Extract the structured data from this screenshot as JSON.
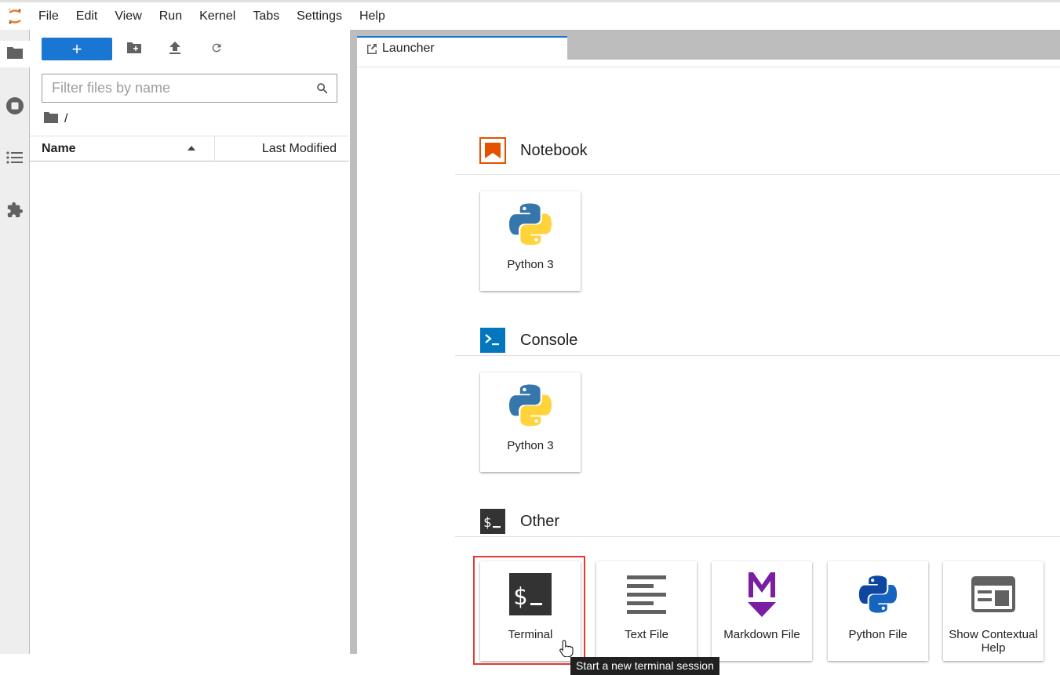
{
  "menubar": {
    "items": [
      "File",
      "Edit",
      "View",
      "Run",
      "Kernel",
      "Tabs",
      "Settings",
      "Help"
    ]
  },
  "activity_bar": {
    "icons": [
      "folder-icon",
      "running-icon",
      "toc-icon",
      "extension-icon"
    ]
  },
  "filebrowser": {
    "new_button_label": "+",
    "filter_placeholder": "Filter files by name",
    "breadcrumb": "/",
    "columns": {
      "name": "Name",
      "last_modified": "Last Modified"
    }
  },
  "dock": {
    "tabs": [
      {
        "label": "Launcher"
      }
    ]
  },
  "launcher": {
    "sections": [
      {
        "title": "Notebook",
        "cards": [
          {
            "label": "Python 3"
          }
        ]
      },
      {
        "title": "Console",
        "cards": [
          {
            "label": "Python 3"
          }
        ]
      },
      {
        "title": "Other",
        "cards": [
          {
            "label": "Terminal"
          },
          {
            "label": "Text File"
          },
          {
            "label": "Markdown File"
          },
          {
            "label": "Python File"
          },
          {
            "label": "Show Contextual Help"
          }
        ]
      }
    ],
    "tooltip": "Start a new terminal session"
  },
  "colors": {
    "accent": "#1976d2",
    "notebook": "#e65100",
    "console": "#0277bd",
    "markdown": "#7b1fa2",
    "highlight": "#e53935"
  }
}
